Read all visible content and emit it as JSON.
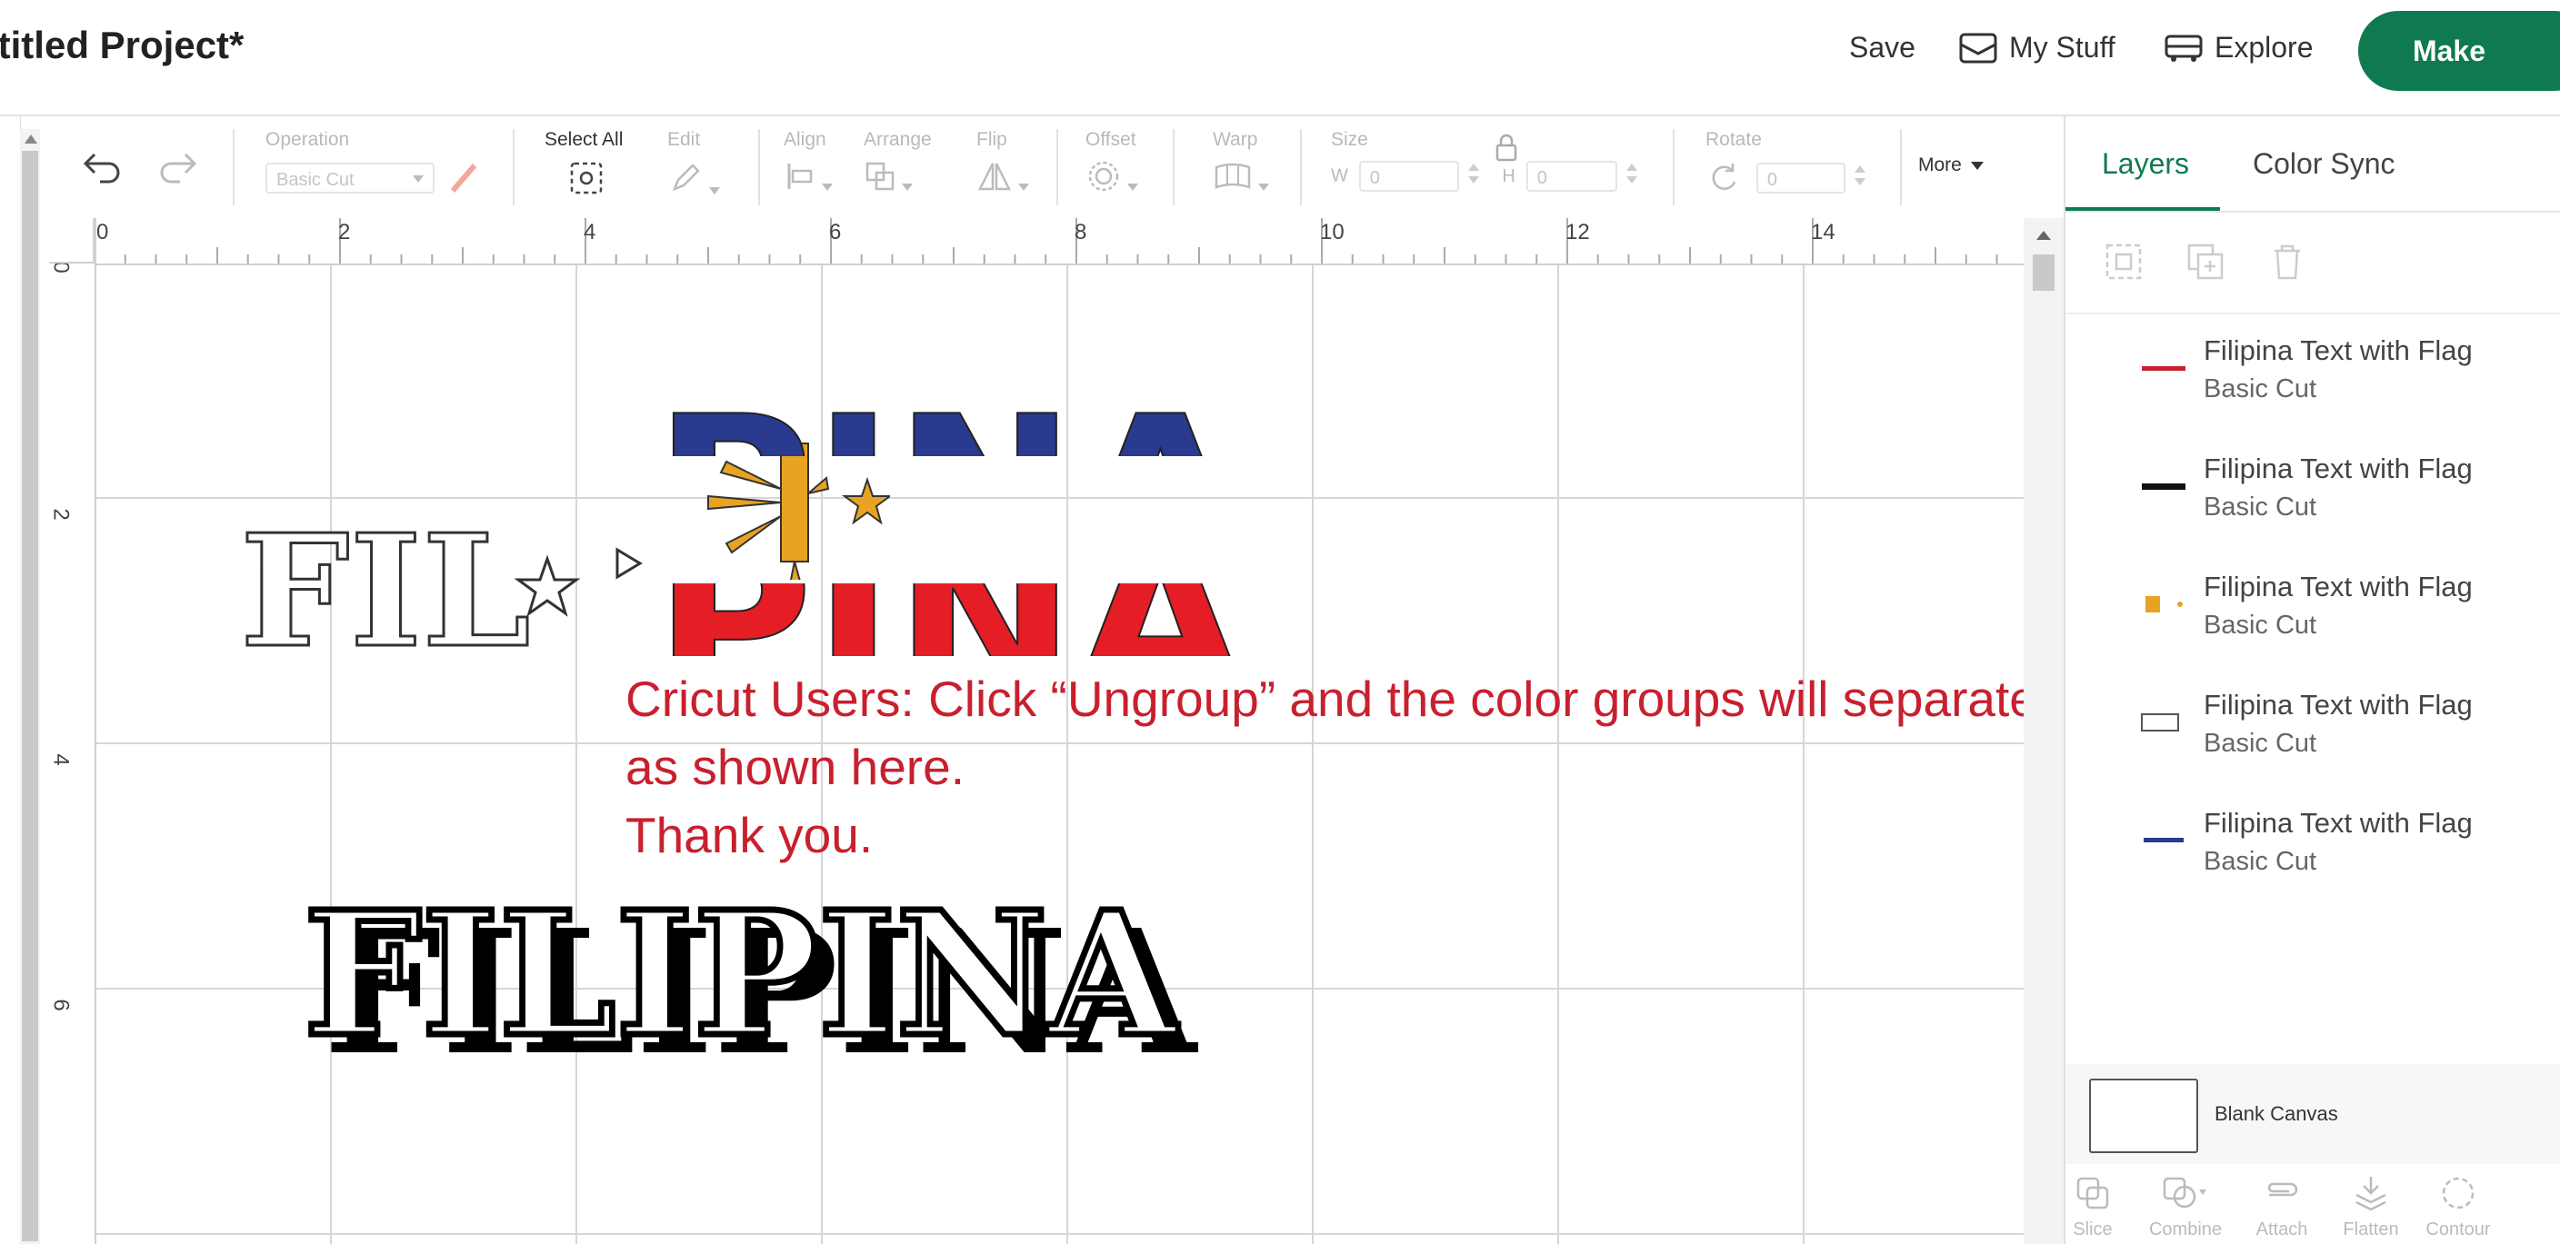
{
  "header": {
    "title": "ntitled Project*",
    "save_label": "Save",
    "mystuff_label": "My Stuff",
    "explore_label": "Explore",
    "make_label": "Make"
  },
  "toolbar": {
    "operation": {
      "label": "Operation",
      "value": "Basic Cut"
    },
    "select_all_label": "Select All",
    "edit_label": "Edit",
    "align_label": "Align",
    "arrange_label": "Arrange",
    "flip_label": "Flip",
    "offset_label": "Offset",
    "warp_label": "Warp",
    "size": {
      "label": "Size",
      "w_label": "W",
      "w_value": "0",
      "h_label": "H",
      "h_value": "0"
    },
    "rotate": {
      "label": "Rotate",
      "value": "0"
    },
    "more_label": "More"
  },
  "rulers": {
    "top": [
      "0",
      "2",
      "4",
      "6",
      "8",
      "10",
      "12",
      "14"
    ],
    "left": [
      "0",
      "2",
      "4",
      "6"
    ]
  },
  "canvas": {
    "note_lines": [
      "Cricut Users: Click “Ungroup” and the color groups will separate",
      "as shown here.",
      "Thank you."
    ],
    "art_text": "FILIPINA",
    "art_fragment_top": "PINA",
    "art_fragment_bottom": "PINA",
    "art_fragment_outline": "FIL"
  },
  "panel": {
    "tabs": [
      "Layers",
      "Color Sync"
    ],
    "active_tab": "Layers",
    "layers": [
      {
        "name": "Filipina Text with Flag",
        "operation": "Basic Cut",
        "thumb_color": "#c8202e"
      },
      {
        "name": "Filipina Text with Flag",
        "operation": "Basic Cut",
        "thumb_color": "#111111"
      },
      {
        "name": "Filipina Text with Flag",
        "operation": "Basic Cut",
        "thumb_color": "#e8a323"
      },
      {
        "name": "Filipina Text with Flag",
        "operation": "Basic Cut",
        "thumb_color": "#555555"
      },
      {
        "name": "Filipina Text with Flag",
        "operation": "Basic Cut",
        "thumb_color": "#2a3a8f"
      }
    ],
    "blank_canvas_label": "Blank Canvas",
    "bottom_tools": [
      "Slice",
      "Combine",
      "Attach",
      "Flatten",
      "Contour"
    ]
  },
  "colors": {
    "accent": "#0f7a4f",
    "note_red": "#c8202e",
    "flag_blue": "#2a3a8f",
    "flag_red": "#e51e25",
    "sun_yellow": "#e8a323"
  }
}
